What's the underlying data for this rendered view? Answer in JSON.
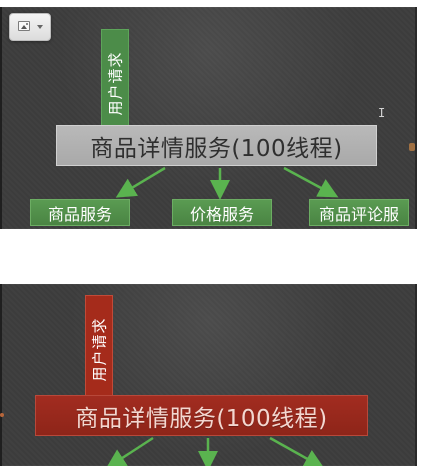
{
  "top_diagram": {
    "request_label": "用户请求",
    "main_label": "商品详情服务(100线程)",
    "services": [
      "商品服务",
      "价格服务",
      "商品评论服"
    ],
    "cursor_glyph": "I",
    "colors": {
      "background": "#3d3d3d",
      "request": "#4c8c49",
      "main": "#b1b1b1",
      "service": "#4f8d48",
      "arrow": "#5ab34f"
    }
  },
  "bottom_diagram": {
    "request_label": "用户请求",
    "main_label": "商品详情服务(100线程)",
    "colors": {
      "background": "#3d3d3d",
      "request": "#a52b1b",
      "main": "#982a1e",
      "arrow": "#5ab34f"
    }
  },
  "icons": {
    "toolbar": "image-icon",
    "toolbar_dropdown": "chevron-down-icon"
  }
}
